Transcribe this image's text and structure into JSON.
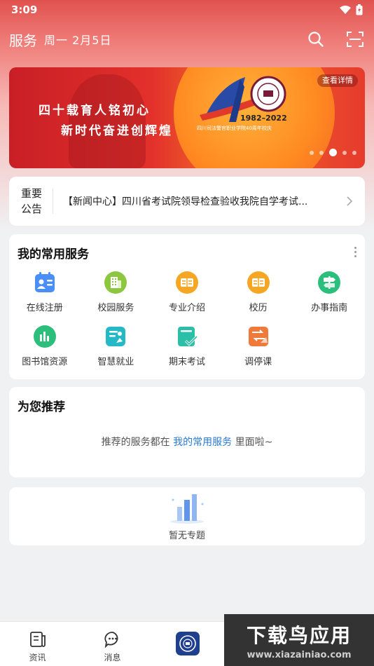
{
  "status_bar": {
    "time": "3:09",
    "battery": "⚡"
  },
  "header": {
    "title": "服务",
    "date": "周一  2月5日"
  },
  "banner": {
    "slogan_line1": "四十载育人铭初心",
    "slogan_line2": "新时代奋进创辉煌",
    "years": "1982–2022",
    "sub": "四川司法警官职业学院40周年校庆",
    "detail_label": "查看详情",
    "slide_count": 5,
    "active_slide": 3
  },
  "notice": {
    "tag": "重要公告",
    "tag_line1": "重要",
    "tag_line2": "公告",
    "text": "【新闻中心】四川省考试院领导检查验收我院自学考试..."
  },
  "services": {
    "title": "我的常用服务",
    "items": [
      {
        "label": "在线注册",
        "icon": "id-card-icon",
        "color": "#4a8ff7"
      },
      {
        "label": "校园服务",
        "icon": "building-icon",
        "color": "#8dc63f"
      },
      {
        "label": "专业介绍",
        "icon": "book-icon",
        "color": "#f5a623"
      },
      {
        "label": "校历",
        "icon": "calendar-book-icon",
        "color": "#f5a623"
      },
      {
        "label": "办事指南",
        "icon": "signpost-icon",
        "color": "#2bbf7b"
      },
      {
        "label": "图书馆资源",
        "icon": "chart-icon",
        "color": "#2bbf7b"
      },
      {
        "label": "智慧就业",
        "icon": "job-icon",
        "color": "#25b9c8"
      },
      {
        "label": "期末考试",
        "icon": "exam-icon",
        "color": "#2bbfa7"
      },
      {
        "label": "调停课",
        "icon": "swap-icon",
        "color": "#f07a3a"
      }
    ]
  },
  "recommend": {
    "title": "为您推荐",
    "msg_prefix": "推荐的服务都在",
    "msg_link": "我的常用服务",
    "msg_suffix": "里面啦~"
  },
  "topics": {
    "empty_label": "暂无专题"
  },
  "tabbar": {
    "items": [
      {
        "label": "资讯",
        "icon": "news-icon"
      },
      {
        "label": "消息",
        "icon": "chat-icon"
      },
      {
        "label": "",
        "icon": "school-logo-icon"
      }
    ]
  },
  "watermark": {
    "title": "下载鸟应用",
    "url": "www.xiazainiao.com"
  },
  "colors": {
    "brand_red": "#e0524e",
    "link_blue": "#2a7ad6"
  }
}
